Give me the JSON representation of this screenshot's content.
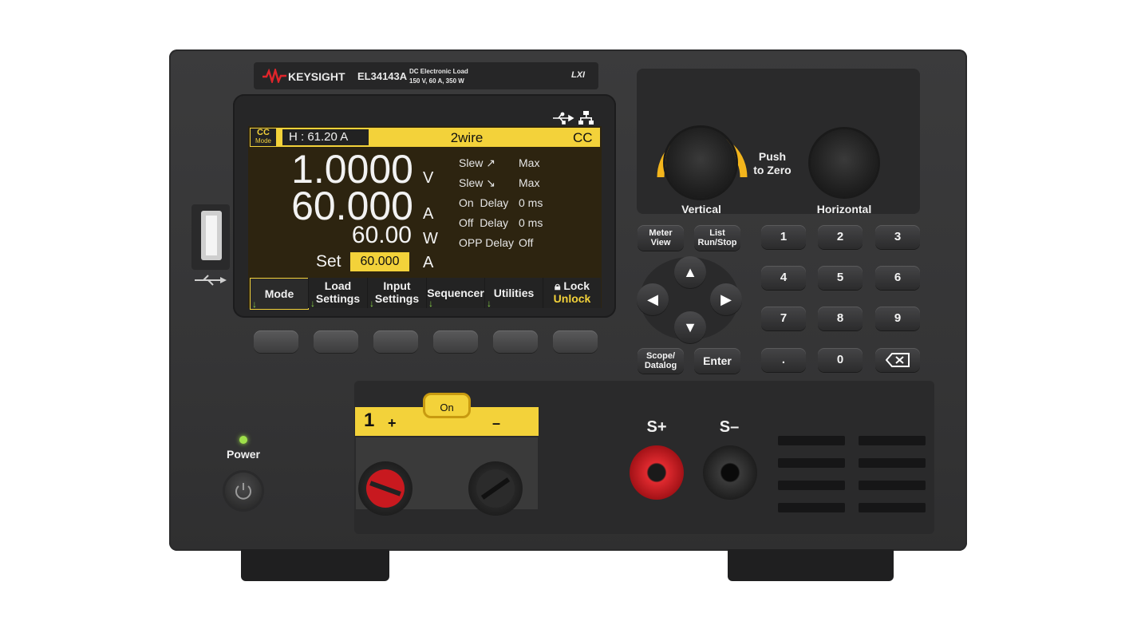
{
  "brand": {
    "logo_text": "KEYSIGHT",
    "model": "EL34143A",
    "desc_line1": "DC Electronic Load",
    "desc_line2": "150 V, 60 A, 350 W",
    "lxi": "LXI"
  },
  "screen": {
    "mode_badge_top": "CC",
    "mode_badge_bottom": "Mode",
    "status_left": "H : 61.20 A",
    "status_center": "2wire",
    "status_right": "CC",
    "voltage": {
      "value": "1.0000",
      "unit": "V"
    },
    "current": {
      "value": "60.000",
      "unit": "A"
    },
    "power": {
      "value": "60.00",
      "unit": "W"
    },
    "set": {
      "label": "Set",
      "value": "60.000",
      "unit": "A"
    },
    "params": [
      {
        "label": "Slew ↗",
        "value": "Max"
      },
      {
        "label": "Slew ↘",
        "value": "Max"
      },
      {
        "label": "On  Delay",
        "value": "0 ms"
      },
      {
        "label": "Off  Delay",
        "value": "0 ms"
      },
      {
        "label": "OPP Delay",
        "value": "Off"
      }
    ],
    "softkeys": [
      {
        "line1": "Mode",
        "line2": ""
      },
      {
        "line1": "Load",
        "line2": "Settings"
      },
      {
        "line1": "Input",
        "line2": "Settings"
      },
      {
        "line1": "Sequencer",
        "line2": ""
      },
      {
        "line1": "Utilities",
        "line2": ""
      },
      {
        "line1": "Lock",
        "line2": "Unlock"
      }
    ]
  },
  "knobs": {
    "vertical": "Vertical",
    "horizontal": "Horizontal",
    "push1": "Push",
    "push2": "to Zero"
  },
  "keys": {
    "meter1": "Meter",
    "meter2": "View",
    "list1": "List",
    "list2": "Run/Stop",
    "scope1": "Scope/",
    "scope2": "Datalog",
    "enter": "Enter",
    "numpad": [
      "1",
      "2",
      "3",
      "4",
      "5",
      "6",
      "7",
      "8",
      "9",
      ".",
      "0"
    ]
  },
  "power": {
    "label": "Power"
  },
  "terminals": {
    "channel": "1",
    "plus": "+",
    "minus": "–",
    "on_label": "On",
    "sense_plus": "S+",
    "sense_minus": "S–"
  },
  "colors": {
    "accent_yellow": "#f3d23a",
    "screen_bg": "#2d2410",
    "body": "#3b3b3c",
    "red_terminal": "#c8191f"
  }
}
